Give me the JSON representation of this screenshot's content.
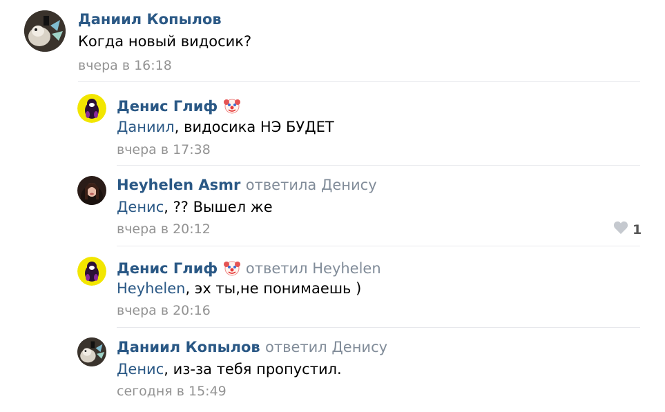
{
  "comments": [
    {
      "author": "Даниил Копылов",
      "reply_to": "",
      "mention": "",
      "text": "Когда новый видосик?",
      "time": "вчера в 16:18"
    },
    {
      "author": "Денис Глиф",
      "reply_to": "",
      "mention": "Даниил",
      "text": ", видосика НЭ БУДЕТ",
      "time": "вчера в 17:38"
    },
    {
      "author": "Heyhelen Asmr",
      "reply_to": "ответила Денису",
      "mention": "Денис",
      "text": ", ?? Вышел же",
      "time": "вчера в 20:12",
      "likes": "1"
    },
    {
      "author": "Денис Глиф",
      "reply_to": "ответил Heyhelen",
      "mention": "Heyhelen",
      "text": ", эх ты,не понимаешь )",
      "time": "вчера в 20:16"
    },
    {
      "author": "Даниил Копылов",
      "reply_to": "ответил Денису",
      "mention": "Денис",
      "text": ", из-за тебя пропустил.",
      "time": "сегодня в 15:49"
    }
  ],
  "icons": {
    "clown": "clown-face-emoji-icon",
    "like": "heart-icon"
  },
  "colors": {
    "link": "#2a5885",
    "meta": "#818c99",
    "time": "#939393",
    "separator": "#e7e8ec",
    "heart": "#c5c9cf"
  }
}
